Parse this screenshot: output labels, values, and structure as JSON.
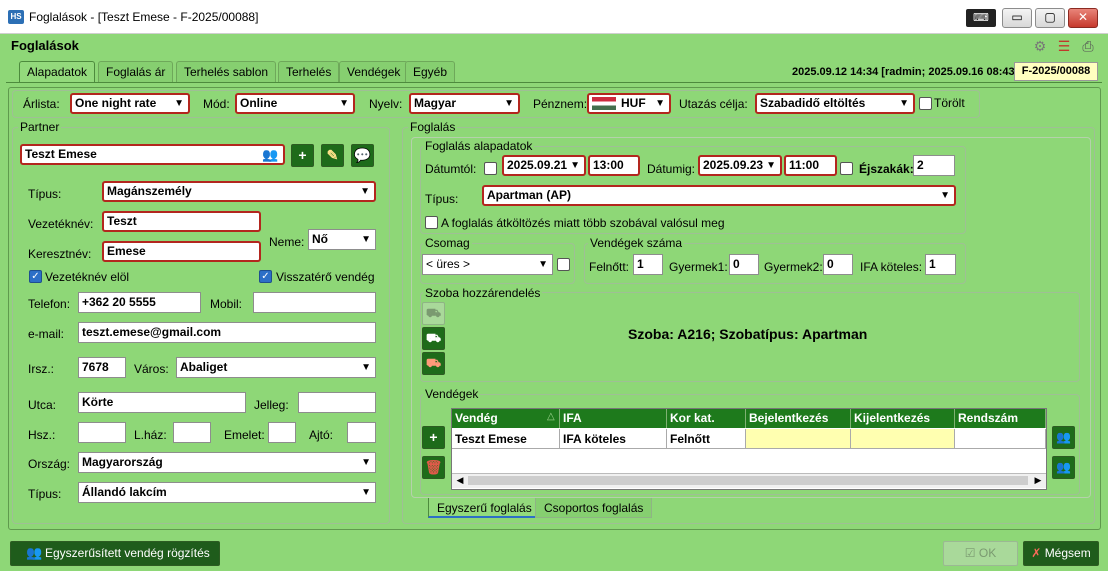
{
  "window": {
    "app_icon": "HS",
    "title": "Foglalások - [Teszt Emese - F-2025/00088]",
    "minimize": "▭",
    "maximize": "▢",
    "close": "✕"
  },
  "header": {
    "title": "Foglalások",
    "status": "2025.09.12 14:34 [radmin; 2025.09.16 08:43]",
    "ref": "F-2025/00088"
  },
  "tabs": [
    "Alapadatok",
    "Foglalás ár",
    "Terhelés sablon",
    "Terhelés",
    "Vendégek",
    "Egyéb"
  ],
  "topbar": {
    "arlista_label": "Árlista:",
    "arlista": "One night rate",
    "mod_label": "Mód:",
    "mod": "Online",
    "nyelv_label": "Nyelv:",
    "nyelv": "Magyar",
    "penznem_label": "Pénznem:",
    "penznem": "HUF",
    "utazas_label": "Utazás célja:",
    "utazas": "Szabadidő eltöltés",
    "torolt_label": "Törölt"
  },
  "partner": {
    "legend": "Partner",
    "name": "Teszt Emese",
    "tipus_label": "Típus:",
    "tipus": "Magánszemély",
    "vezeteknev_label": "Vezetéknév:",
    "vezeteknev": "Teszt",
    "keresztnev_label": "Keresztnév:",
    "keresztnev": "Emese",
    "neme_label": "Neme:",
    "neme": "Nő",
    "vezeteknev_elol": "Vezetéknév elöl",
    "visszatero": "Visszatérő vendég",
    "telefon_label": "Telefon:",
    "telefon": "+362 20 5555",
    "mobil_label": "Mobil:",
    "mobil": "",
    "email_label": "e-mail:",
    "email": "teszt.emese@gmail.com",
    "irsz_label": "Irsz.:",
    "irsz": "7678",
    "varos_label": "Város:",
    "varos": "Abaliget",
    "utca_label": "Utca:",
    "utca": "Körte",
    "jelleg_label": "Jelleg:",
    "hsz_label": "Hsz.:",
    "lhaz_label": "L.ház:",
    "emelet_label": "Emelet:",
    "ajto_label": "Ajtó:",
    "orszag_label": "Ország:",
    "orszag": "Magyarország",
    "tipus2_label": "Típus:",
    "tipus2": "Állandó lakcím"
  },
  "foglalas": {
    "legend": "Foglalás",
    "alap_legend": "Foglalás alapadatok",
    "datumtol_label": "Dátumtól:",
    "datumtol": "2025.09.21",
    "ido1": "13:00",
    "datumig_label": "Dátumig:",
    "datumig": "2025.09.23",
    "ido2": "11:00",
    "ejszakak_label": "Éjszakák:",
    "ejszakak": "2",
    "tipus_label": "Típus:",
    "tipus": "Apartman (AP)",
    "atkoltozes": "A foglalás átköltözés miatt több szobával valósul meg",
    "csomag_legend": "Csomag",
    "csomag": "< üres >",
    "vendegek_szama_legend": "Vendégek száma",
    "felnott_label": "Felnőtt:",
    "felnott": "1",
    "gyermek1_label": "Gyermek1:",
    "gyermek1": "0",
    "gyermek2_label": "Gyermek2:",
    "gyermek2": "0",
    "ifa_label": "IFA köteles:",
    "ifa": "1",
    "szoba_legend": "Szoba hozzárendelés",
    "szoba_info": "Szoba: A216; Szobatípus: Apartman",
    "vendegek_legend": "Vendégek"
  },
  "grid": {
    "headers": [
      "Vendég",
      "IFA",
      "Kor kat.",
      "Bejelentkezés",
      "Kijelentkezés",
      "Rendszám"
    ],
    "sort_glyph": "△",
    "rows": [
      [
        "Teszt Emese",
        "IFA köteles",
        "Felnőtt",
        "",
        "",
        ""
      ]
    ]
  },
  "bottom_tabs": [
    "Egyszerű foglalás",
    "Csoportos foglalás"
  ],
  "footer": {
    "quick_guest": "Egyszerűsített vendég rögzítés",
    "ok": "OK",
    "cancel": "Mégsem"
  },
  "colors": {
    "background": "#8ed777",
    "required_border": "#b3261e",
    "grid_header": "#1e7a1c"
  }
}
